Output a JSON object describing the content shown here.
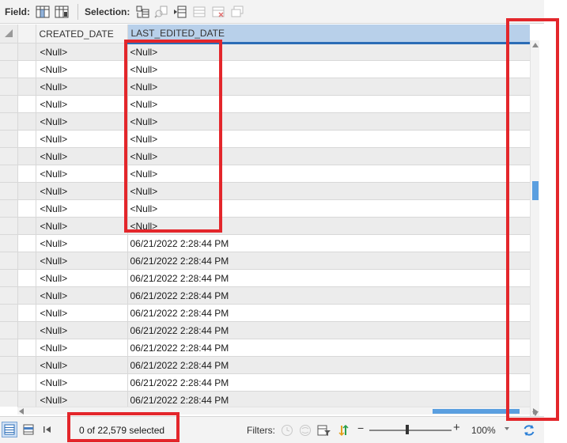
{
  "toolbar": {
    "field_label": "Field:",
    "selection_label": "Selection:"
  },
  "table": {
    "columns": [
      "CREATED_DATE",
      "LAST_EDITED_DATE"
    ],
    "rows": [
      [
        "<Null>",
        "<Null>"
      ],
      [
        "<Null>",
        "<Null>"
      ],
      [
        "<Null>",
        "<Null>"
      ],
      [
        "<Null>",
        "<Null>"
      ],
      [
        "<Null>",
        "<Null>"
      ],
      [
        "<Null>",
        "<Null>"
      ],
      [
        "<Null>",
        "<Null>"
      ],
      [
        "<Null>",
        "<Null>"
      ],
      [
        "<Null>",
        "<Null>"
      ],
      [
        "<Null>",
        "<Null>"
      ],
      [
        "<Null>",
        "<Null>"
      ],
      [
        "<Null>",
        "06/21/2022 2:28:44 PM"
      ],
      [
        "<Null>",
        "06/21/2022 2:28:44 PM"
      ],
      [
        "<Null>",
        "06/21/2022 2:28:44 PM"
      ],
      [
        "<Null>",
        "06/21/2022 2:28:44 PM"
      ],
      [
        "<Null>",
        "06/21/2022 2:28:44 PM"
      ],
      [
        "<Null>",
        "06/21/2022 2:28:44 PM"
      ],
      [
        "<Null>",
        "06/21/2022 2:28:44 PM"
      ],
      [
        "<Null>",
        "06/21/2022 2:28:44 PM"
      ],
      [
        "<Null>",
        "06/21/2022 2:28:44 PM"
      ],
      [
        "<Null>",
        "06/21/2022 2:28:44 PM"
      ],
      [
        "<Null>",
        "06/21/2022 2:28:44 PM"
      ]
    ]
  },
  "status": {
    "selection_count": "0 of 22,579 selected",
    "filters_label": "Filters:",
    "zoom": "100%"
  },
  "colors": {
    "accent": "#2b6cb6",
    "annotation": "#e3262b",
    "scroll_thumb": "#5a9fe0"
  }
}
